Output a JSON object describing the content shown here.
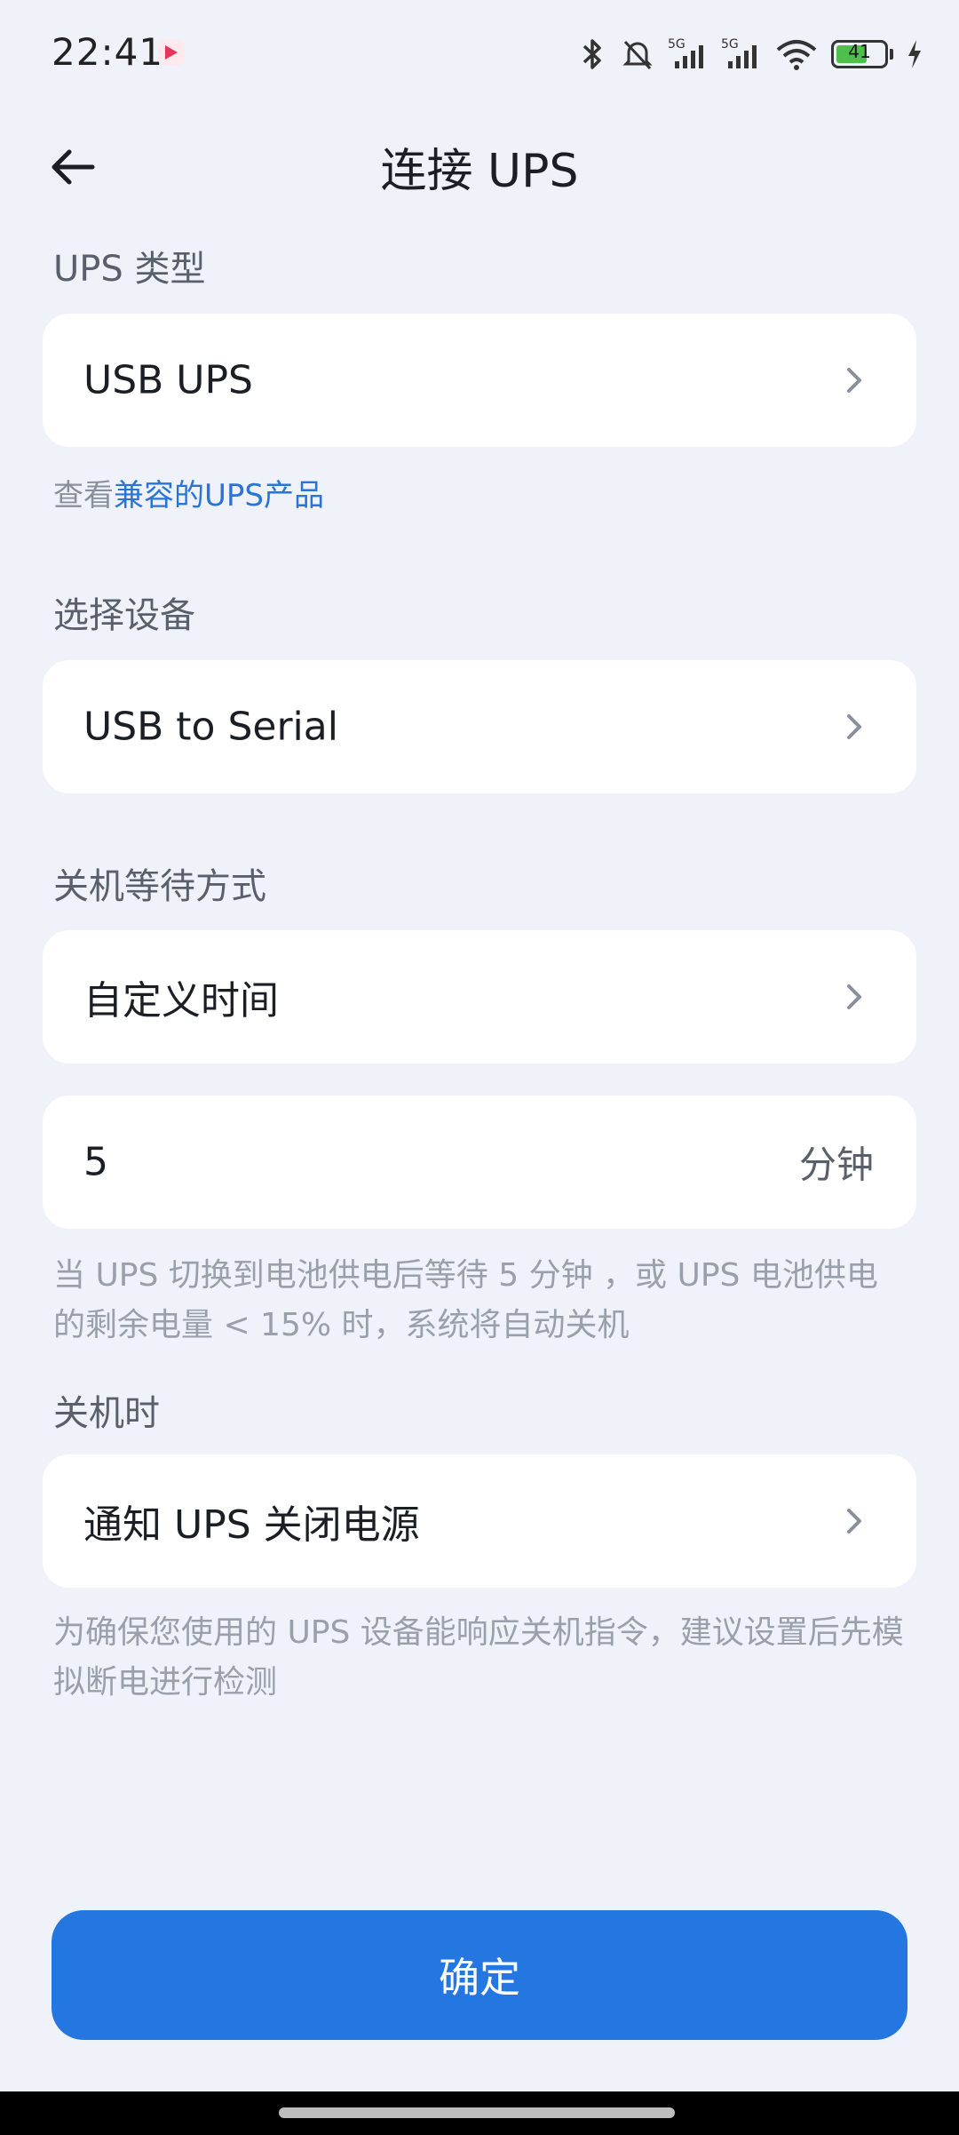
{
  "status_bar": {
    "time": "22:41",
    "battery_level": "41",
    "network_labels": [
      "5G",
      "5G"
    ]
  },
  "header": {
    "title": "连接 UPS"
  },
  "ups_type": {
    "section_label": "UPS 类型",
    "value": "USB UPS",
    "compat_prefix": "查看",
    "compat_link": "兼容的UPS产品"
  },
  "device": {
    "section_label": "选择设备",
    "value": "USB to Serial"
  },
  "shutdown_wait": {
    "section_label": "关机等待方式",
    "mode": "自定义时间",
    "minutes": "5",
    "unit": "分钟",
    "hint": "当 UPS 切换到电池供电后等待 5 分钟 ，或 UPS 电池供电的剩余电量 < 15% 时，系统将自动关机"
  },
  "on_shutdown": {
    "section_label": "关机时",
    "value": "通知 UPS 关闭电源",
    "hint": "为确保您使用的 UPS 设备能响应关机指令，建议设置后先模拟断电进行检测"
  },
  "confirm_label": "确定",
  "colors": {
    "background": "#eff2f8",
    "accent": "#2477e0",
    "link": "#2a74d8"
  }
}
